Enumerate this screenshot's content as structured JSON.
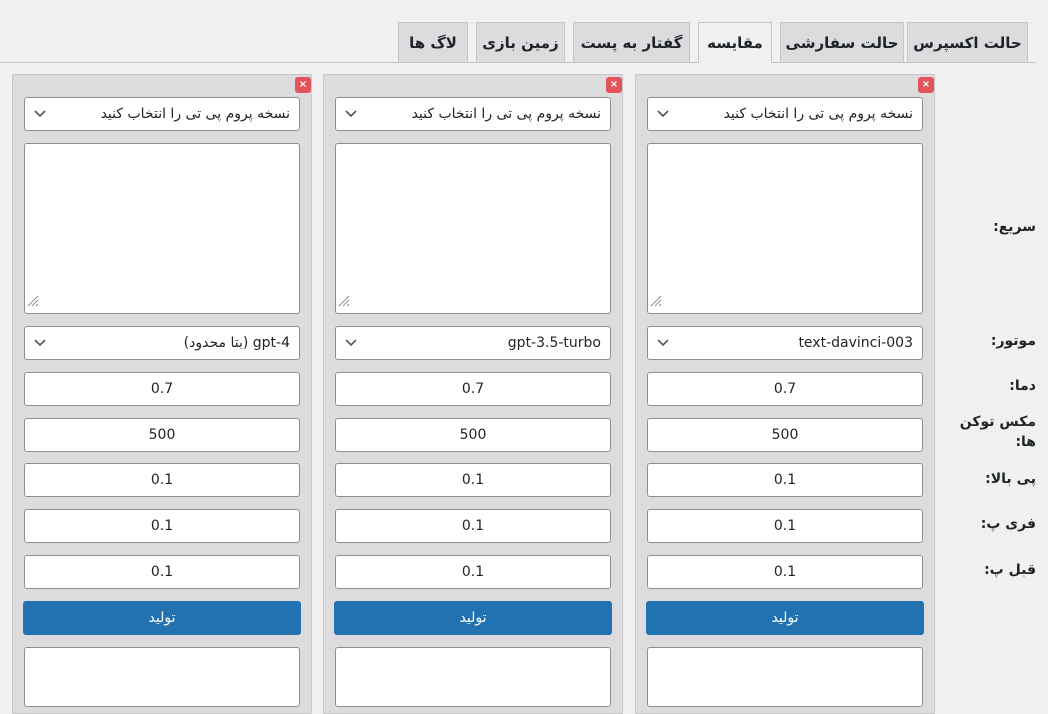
{
  "tabs": [
    {
      "label": "حالت اکسپرس"
    },
    {
      "label": "حالت سفارشی"
    },
    {
      "label": "مقایسه",
      "active": true
    },
    {
      "label": "گفتار به پست"
    },
    {
      "label": "زمین بازی"
    },
    {
      "label": "لاگ ها"
    }
  ],
  "labels": {
    "quick": "سریع:",
    "engine": "موتور:",
    "temperature": "دما:",
    "max_tokens": "مکس توکن ها:",
    "top_p": "پی بالا:",
    "freq_p": "فری پ:",
    "pres_p": "قبل پ:"
  },
  "columns": [
    {
      "close": "×",
      "preset_placeholder": "نسخه پروم پی تی را انتخاب کنید",
      "prompt_value": "",
      "engine": "text-davinci-003",
      "temperature": "0.7",
      "max_tokens": "500",
      "top_p": "0.1",
      "frequency_penalty": "0.1",
      "presence_penalty": "0.1",
      "generate_label": "تولید"
    },
    {
      "close": "×",
      "preset_placeholder": "نسخه پروم پی تی را انتخاب کنید",
      "prompt_value": "",
      "engine": "gpt-3.5-turbo",
      "temperature": "0.7",
      "max_tokens": "500",
      "top_p": "0.1",
      "frequency_penalty": "0.1",
      "presence_penalty": "0.1",
      "generate_label": "تولید"
    },
    {
      "close": "×",
      "preset_placeholder": "نسخه پروم پی تی را انتخاب کنید",
      "prompt_value": "",
      "engine": "gpt-4 (بتا محدود)",
      "temperature": "0.7",
      "max_tokens": "500",
      "top_p": "0.1",
      "frequency_penalty": "0.1",
      "presence_penalty": "0.1",
      "generate_label": "تولید"
    }
  ],
  "colors": {
    "accent": "#2271b1",
    "close": "#e2535b",
    "panel": "#dcdcde",
    "background": "#f0f0f1"
  },
  "icons": {
    "close": "close-icon",
    "dropdown": "chevron-down-icon",
    "resize": "resize-grip-icon"
  }
}
